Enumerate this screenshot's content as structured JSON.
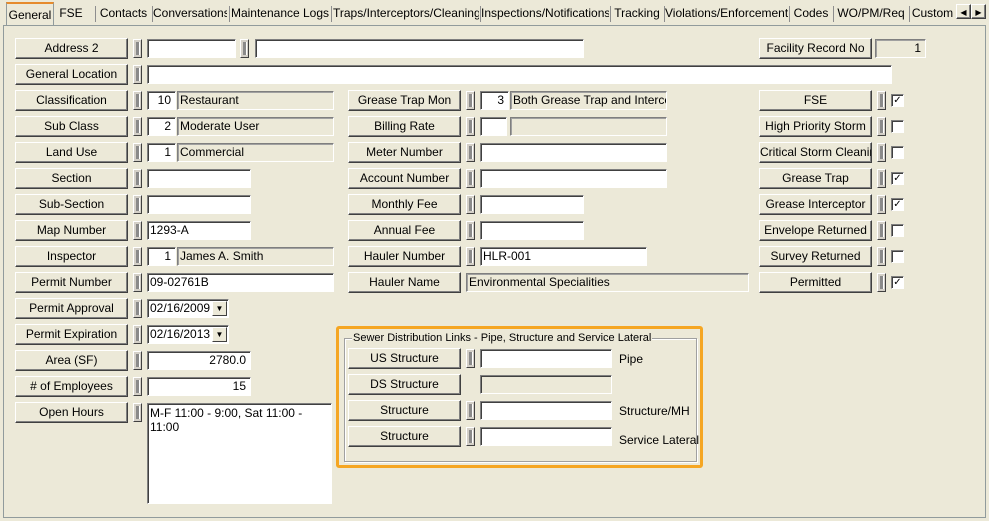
{
  "tabs": [
    "General",
    "FSE",
    "Contacts",
    "Conversations",
    "Maintenance Logs",
    "Traps/Interceptors/Cleanings",
    "Inspections/Notifications",
    "Tracking",
    "Violations/Enforcements",
    "Codes",
    "WO/PM/Req",
    "Custom"
  ],
  "tab_scroll": {
    "left": "◀",
    "right": "▶"
  },
  "left": {
    "address2": {
      "label": "Address 2",
      "value1": "",
      "value2": ""
    },
    "general_location": {
      "label": "General Location",
      "value": ""
    },
    "classification": {
      "label": "Classification",
      "code": "10",
      "desc": "Restaurant"
    },
    "sub_class": {
      "label": "Sub Class",
      "code": "2",
      "desc": "Moderate User"
    },
    "land_use": {
      "label": "Land Use",
      "code": "1",
      "desc": "Commercial"
    },
    "section": {
      "label": "Section",
      "value": ""
    },
    "sub_section": {
      "label": "Sub-Section",
      "value": ""
    },
    "map_number": {
      "label": "Map Number",
      "value": "1293-A"
    },
    "inspector": {
      "label": "Inspector",
      "code": "1",
      "desc": "James A. Smith"
    },
    "permit_number": {
      "label": "Permit Number",
      "value": "09-02761B"
    },
    "permit_approval": {
      "label": "Permit Approval",
      "value": "02/16/2009"
    },
    "permit_expiration": {
      "label": "Permit Expiration",
      "value": "02/16/2013"
    },
    "area": {
      "label": "Area (SF)",
      "value": "2780.0"
    },
    "employees": {
      "label": "# of Employees",
      "value": "15"
    },
    "open_hours": {
      "label": "Open Hours",
      "value": "M-F 11:00 - 9:00, Sat 11:00 - 11:00"
    }
  },
  "middle": {
    "grease_trap_mon": {
      "label": "Grease Trap Mon",
      "code": "3",
      "desc": "Both Grease Trap and Intercept"
    },
    "billing_rate": {
      "label": "Billing Rate",
      "code": "",
      "desc": ""
    },
    "meter_number": {
      "label": "Meter Number",
      "value": ""
    },
    "account_number": {
      "label": "Account Number",
      "value": ""
    },
    "monthly_fee": {
      "label": "Monthly Fee",
      "value": ""
    },
    "annual_fee": {
      "label": "Annual Fee",
      "value": ""
    },
    "hauler_number": {
      "label": "Hauler Number",
      "value": "HLR-001"
    },
    "hauler_name": {
      "label": "Hauler Name",
      "value": "Environmental Specialities"
    }
  },
  "sewer": {
    "title": "Sewer Distribution Links - Pipe, Structure and Service Lateral",
    "us_structure": {
      "label": "US Structure",
      "value": "",
      "type": "Pipe"
    },
    "ds_structure": {
      "label": "DS Structure",
      "value": ""
    },
    "structure1": {
      "label": "Structure",
      "value": "",
      "type": "Structure/MH"
    },
    "structure2": {
      "label": "Structure",
      "value": "",
      "type": "Service Lateral"
    }
  },
  "right": {
    "facility_record": {
      "label": "Facility Record No",
      "value": "1"
    },
    "flags": [
      {
        "label": "FSE",
        "checked": true
      },
      {
        "label": "High Priority Storm",
        "checked": false
      },
      {
        "label": "Critical Storm Cleaning",
        "checked": false
      },
      {
        "label": "Grease Trap",
        "checked": true
      },
      {
        "label": "Grease Interceptor",
        "checked": true
      },
      {
        "label": "Envelope Returned",
        "checked": false
      },
      {
        "label": "Survey Returned",
        "checked": false
      },
      {
        "label": "Permitted",
        "checked": true
      }
    ],
    "check_glyph": "✓"
  },
  "dropdown_glyph": "▼"
}
